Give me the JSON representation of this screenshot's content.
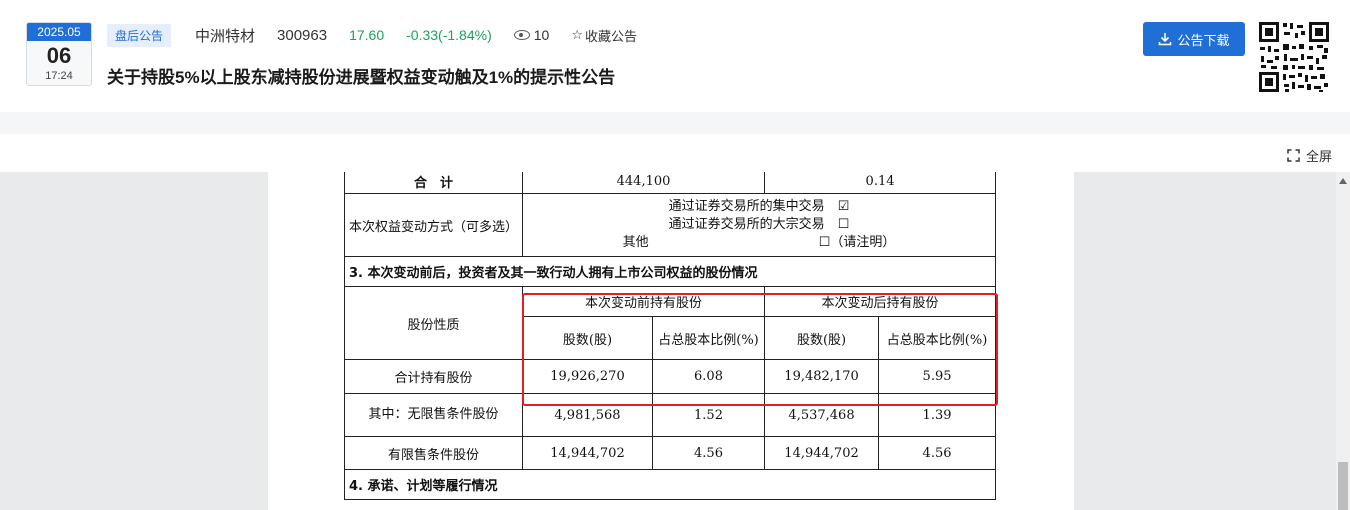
{
  "header": {
    "date_ym": "2025.05",
    "date_day": "06",
    "date_time": "17:24",
    "tag": "盘后公告",
    "stock_name": "中洲特材",
    "stock_code": "300963",
    "price": "17.60",
    "change": "-0.33(-1.84%)",
    "views": "10",
    "favorite_label": "收藏公告",
    "title": "关于持股5%以上股东减持股份进展暨权益变动触及1%的提示性公告",
    "download_label": "公告下载"
  },
  "toolbar": {
    "fullscreen_label": "全屏"
  },
  "doc": {
    "total_label": "合　计",
    "total_shares": "444,100",
    "total_ratio": "0.14",
    "method_label": "本次权益变动方式（可多选）",
    "method_options": [
      {
        "label": "通过证券交易所的集中交易",
        "mark": "☑"
      },
      {
        "label": "通过证券交易所的大宗交易",
        "mark": "☐"
      },
      {
        "label": "其他",
        "mark": "☐（请注明）"
      }
    ],
    "section3_title": "3. 本次变动前后，投资者及其一致行动人拥有上市公司权益的股份情况",
    "share_nature_label": "股份性质",
    "before_label": "本次变动前持有股份",
    "after_label": "本次变动后持有股份",
    "col_shares": "股数(股)",
    "col_ratio": "占总股本比例(%)",
    "rows": [
      {
        "label": "合计持有股份",
        "before_shares": "19,926,270",
        "before_ratio": "6.08",
        "after_shares": "19,482,170",
        "after_ratio": "5.95"
      },
      {
        "label": "其中：无限售条件股份",
        "before_shares": "4,981,568",
        "before_ratio": "1.52",
        "after_shares": "4,537,468",
        "after_ratio": "1.39"
      },
      {
        "label": "有限售条件股份",
        "before_shares": "14,944,702",
        "before_ratio": "4.56",
        "after_shares": "14,944,702",
        "after_ratio": "4.56"
      }
    ],
    "section4_title": "4. 承诺、计划等履行情况"
  },
  "colors": {
    "accent": "#1f6fd6",
    "up_down": "#1aa35a",
    "highlight": "#e02020"
  }
}
